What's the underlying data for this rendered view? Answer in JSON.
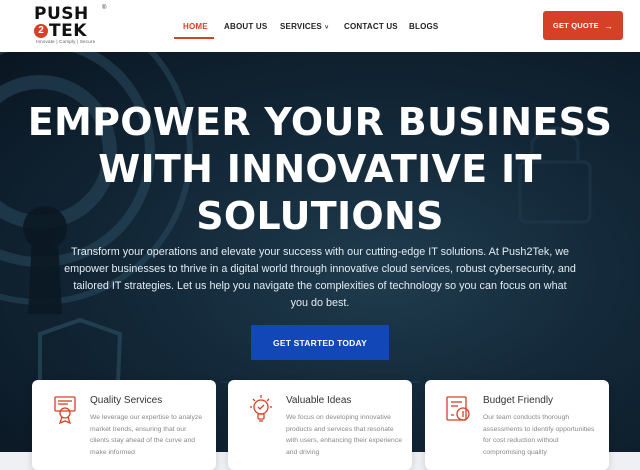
{
  "brand": {
    "logo_text_top": "PUSH",
    "logo_text_bottom": "TEK",
    "logo_digit": "2",
    "tagline": "Innovate | Comply | Secure",
    "reg_mark": "®",
    "accent_color": "#d64026",
    "cta_color": "#1147b7"
  },
  "nav": {
    "items": [
      {
        "label": "HOME",
        "active": true
      },
      {
        "label": "ABOUT US"
      },
      {
        "label": "SERVICES",
        "icon": "chevron-down-icon",
        "glyph": "˅"
      },
      {
        "label": "CONTACT US"
      },
      {
        "label": "BLOGS"
      }
    ],
    "quote_label": "GET QUOTE",
    "quote_icon": "→"
  },
  "hero": {
    "headline_lines": [
      "EMPOWER YOUR BUSINESS",
      "WITH INNOVATIVE IT",
      "SOLUTIONS"
    ],
    "subtext": "Transform your operations and elevate your success with our cutting-edge IT solutions. At Push2Tek, we empower businesses to thrive in a digital world through innovative cloud services, robust cybersecurity, and tailored IT strategies. Let us help you navigate the complexities of technology so you can focus on what you do best.",
    "cta_label": "GET STARTED TODAY"
  },
  "cards": [
    {
      "title": "Quality Services",
      "icon": "award-icon",
      "text": "We leverage our expertise to analyze market trends, ensuring that our clients stay ahead of the curve and make informed"
    },
    {
      "title": "Valuable Ideas",
      "icon": "lightbulb-icon",
      "text": "We focus on developing innovative products and services that resonate with users, enhancing their experience and driving"
    },
    {
      "title": "Budget Friendly",
      "icon": "budget-report-icon",
      "text": "Our team conducts thorough assessments to identify opportunities for cost reduction without compromising quality"
    }
  ]
}
